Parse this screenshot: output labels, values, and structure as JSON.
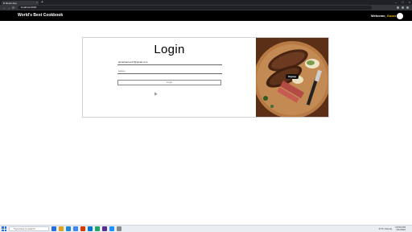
{
  "browser": {
    "tab_title": "React App",
    "url": "localhost:3000",
    "new_tab": "+",
    "tab_close": "×",
    "controls": [
      "–",
      "□",
      "×"
    ],
    "nav": [
      "←",
      "→",
      "⟳"
    ]
  },
  "header": {
    "brand": "World's Best Cookbook",
    "welcome_prefix": "Welcome,",
    "username": "Guest"
  },
  "login": {
    "title": "Login",
    "email_value": "jamiebarnes17@gmail.com",
    "password_value": "••••••••",
    "button_label": "Login"
  },
  "hero": {
    "signup_label": "Signup"
  },
  "taskbar": {
    "search_placeholder": "Type here to search",
    "tray_text": "37°F Cloudy",
    "time": "10:53 PM",
    "date": "3/1/2022"
  },
  "colors": {
    "header_bg": "#000000",
    "username": "#f4c20d",
    "chrome_dark": "#202124"
  }
}
